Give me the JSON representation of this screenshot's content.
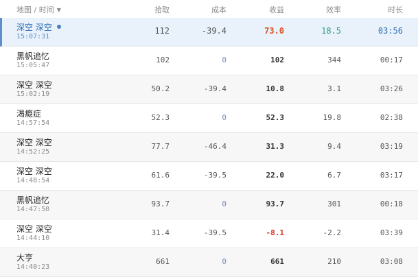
{
  "header": {
    "name_time": "地图 / 时间",
    "pick": "拾取",
    "cost": "成本",
    "profit": "收益",
    "efficiency": "效率",
    "duration": "时长"
  },
  "rows": [
    {
      "name": "深空 深空",
      "time": "15:07:31",
      "pick": "112",
      "cost": "-39.4",
      "profit": "73.0",
      "efficiency": "18.5",
      "duration": "03:56"
    },
    {
      "name": "黑帆追忆",
      "time": "15:05:47",
      "pick": "102",
      "cost": "0",
      "profit": "102",
      "efficiency": "344",
      "duration": "00:17"
    },
    {
      "name": "深空 深空",
      "time": "15:02:19",
      "pick": "50.2",
      "cost": "-39.4",
      "profit": "10.8",
      "efficiency": "3.1",
      "duration": "03:26"
    },
    {
      "name": "渴瘾症",
      "time": "14:57:54",
      "pick": "52.3",
      "cost": "0",
      "profit": "52.3",
      "efficiency": "19.8",
      "duration": "02:38"
    },
    {
      "name": "深空 深空",
      "time": "14:52:25",
      "pick": "77.7",
      "cost": "-46.4",
      "profit": "31.3",
      "efficiency": "9.4",
      "duration": "03:19"
    },
    {
      "name": "深空 深空",
      "time": "14:48:54",
      "pick": "61.6",
      "cost": "-39.5",
      "profit": "22.0",
      "efficiency": "6.7",
      "duration": "03:17"
    },
    {
      "name": "黑帆追忆",
      "time": "14:47:50",
      "pick": "93.7",
      "cost": "0",
      "profit": "93.7",
      "efficiency": "301",
      "duration": "00:18"
    },
    {
      "name": "深空 深空",
      "time": "14:44:10",
      "pick": "31.4",
      "cost": "-39.5",
      "profit": "-8.1",
      "efficiency": "-2.2",
      "duration": "03:39"
    },
    {
      "name": "大亨",
      "time": "14:40:23",
      "pick": "661",
      "cost": "0",
      "profit": "661",
      "efficiency": "210",
      "duration": "03:08"
    }
  ],
  "colors": {
    "active_row_bg": "#e9f2fb",
    "active_accent": "#5d8ec9",
    "profit_positive_active": "#d9542a",
    "profit_negative": "#d9342a",
    "efficiency_active": "#2a9d7c"
  },
  "icons": {
    "sort": "caret-down-icon",
    "current": "dot-indicator-icon"
  }
}
